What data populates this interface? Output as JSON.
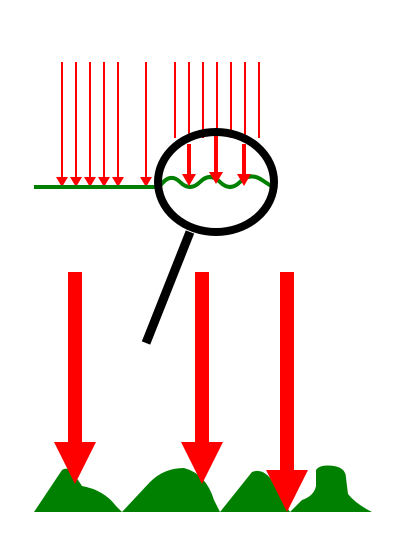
{
  "colors": {
    "background": "#ffffff",
    "arrow": "#ff0000",
    "surface": "#008000",
    "magnifier": "#000000"
  }
}
